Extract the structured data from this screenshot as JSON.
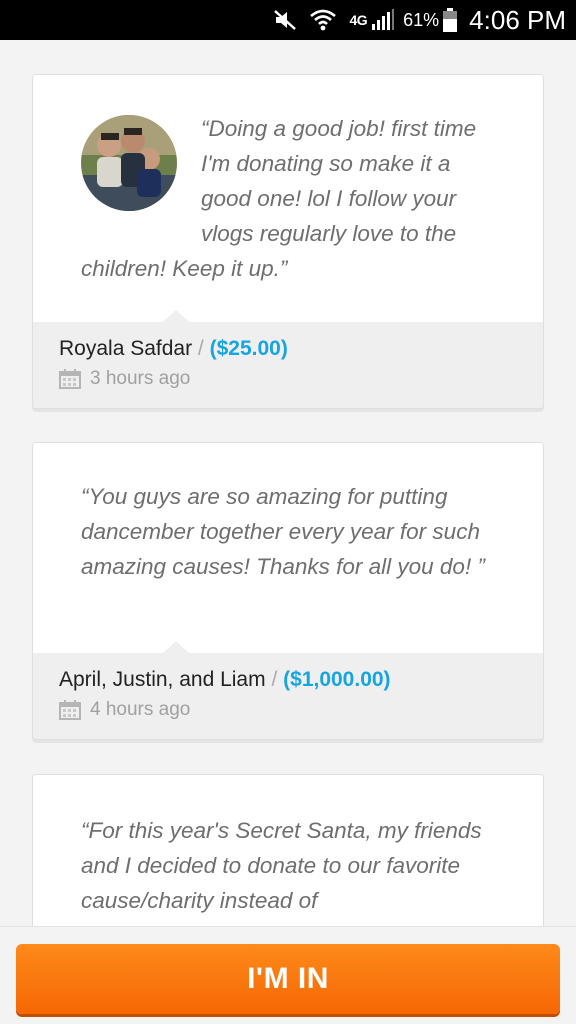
{
  "status_bar": {
    "network": "4G",
    "battery": "61%",
    "time": "4:06 PM"
  },
  "donations": [
    {
      "message": "“Doing a good job! first time I'm donating so make it a good one! lol I follow your vlogs regularly love to the children! Keep it up.”",
      "donor": "Royala Safdar",
      "separator": "/",
      "amount": "($25.00)",
      "time_ago": "3 hours ago"
    },
    {
      "message": "“You guys are so amazing for putting dancember together every year for such amazing causes! Thanks for all you do! ”",
      "donor": "April, Justin, and Liam",
      "separator": "/",
      "amount": "($1,000.00)",
      "time_ago": "4 hours ago"
    },
    {
      "message": "“For this year's Secret Santa, my friends and I decided to donate to our favorite cause/charity instead of"
    }
  ],
  "cta": {
    "label": "I'M IN"
  },
  "colors": {
    "accent_amount": "#17a5e0",
    "cta_orange": "#f7720a"
  },
  "icons": {
    "mute": "mute-icon",
    "wifi": "wifi-icon",
    "signal": "signal-icon",
    "battery": "battery-icon",
    "calendar": "calendar-icon"
  }
}
